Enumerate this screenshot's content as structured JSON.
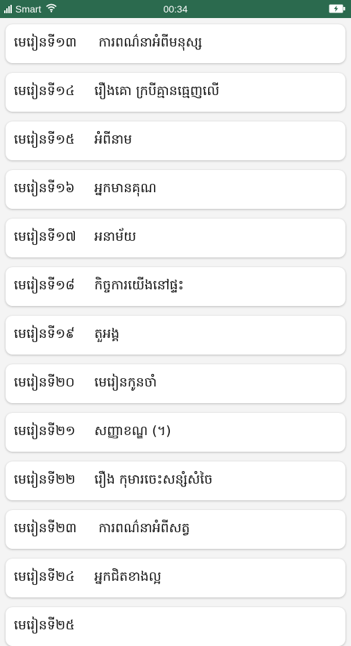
{
  "status_bar": {
    "carrier": "Smart",
    "time": "00:34",
    "colors": {
      "background": "#2b6a4e",
      "text": "#ffffff"
    },
    "icons": [
      "signal-icon",
      "wifi-icon",
      "battery-charging-icon"
    ]
  },
  "lessons": [
    {
      "number": "មេរៀនទី១៣",
      "title": "ការពណ៌នាអំពីមនុស្ស"
    },
    {
      "number": "មេរៀនទី១៤",
      "title": "រឿងគោ ក្របីគ្មានធ្មេញលើ"
    },
    {
      "number": "មេរៀនទី១៥",
      "title": "អំពីនាម"
    },
    {
      "number": "មេរៀនទី១៦",
      "title": "អ្នកមានគុណ"
    },
    {
      "number": "មេរៀនទី១៧",
      "title": "អនាម័យ"
    },
    {
      "number": "មេរៀនទី១៨",
      "title": "កិច្ចការយើងនៅផ្ទះ"
    },
    {
      "number": "មេរៀនទី១៩",
      "title": "តួអង្គ"
    },
    {
      "number": "មេរៀនទី២០",
      "title": "មេរៀនកូនចាំ"
    },
    {
      "number": "មេរៀនទី២១",
      "title": "សញ្ញាខណ្ឌ (។)"
    },
    {
      "number": "មេរៀនទី២២",
      "title": "រឿង កុមារចេះសន្សំសំចៃ"
    },
    {
      "number": "មេរៀនទី២៣",
      "title": "ការពណ៌នាអំពីសត្វ"
    },
    {
      "number": "មេរៀនទី២៤",
      "title": "អ្នកជិតខាងល្អ"
    },
    {
      "number": "មេរៀនទី២៥",
      "title": ""
    }
  ]
}
